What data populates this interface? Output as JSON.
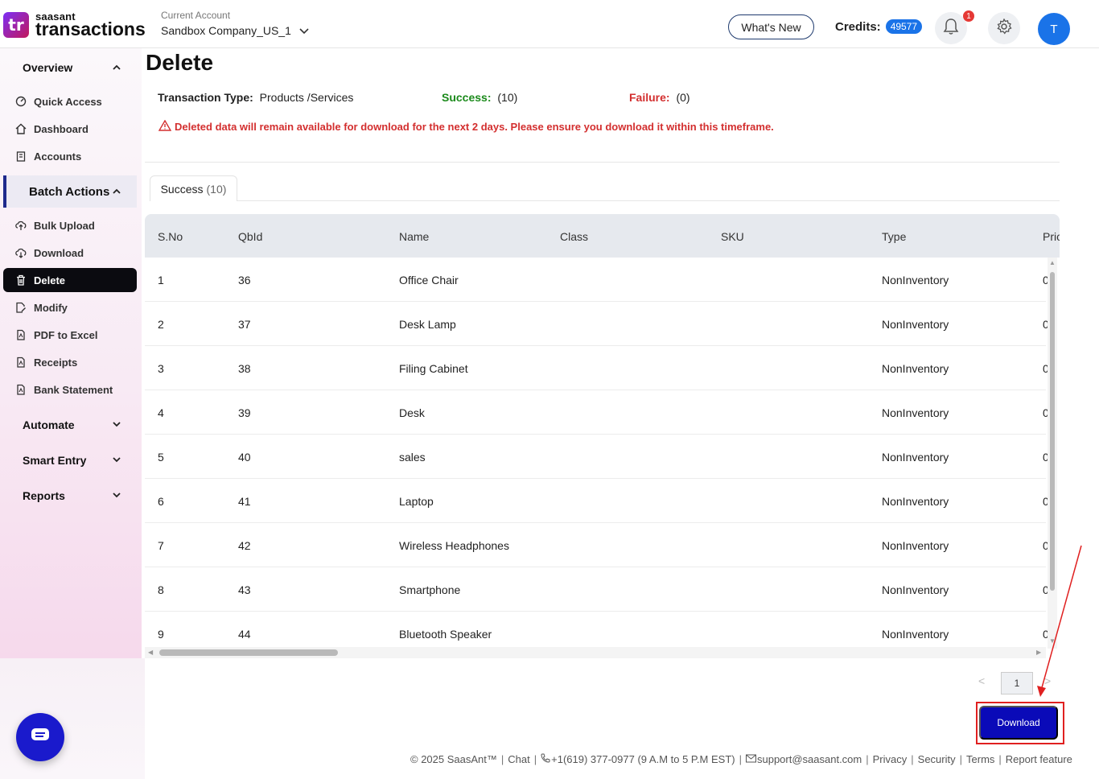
{
  "header": {
    "brand": "saasant",
    "product": "transactions",
    "logo_mark": "tr",
    "account_caption": "Current Account",
    "account_name": "Sandbox Company_US_1",
    "whats_new": "What's New",
    "credits_label": "Credits:",
    "credits_value": "49577",
    "notification_count": "1",
    "avatar_initial": "T"
  },
  "sidebar": {
    "overview": "Overview",
    "overview_items": [
      {
        "label": "Quick Access",
        "icon": "gauge-icon"
      },
      {
        "label": "Dashboard",
        "icon": "home-icon"
      },
      {
        "label": "Accounts",
        "icon": "clipboard-icon"
      }
    ],
    "batch_actions": "Batch Actions",
    "batch_items": [
      {
        "label": "Bulk Upload",
        "icon": "cloud-upload-icon"
      },
      {
        "label": "Download",
        "icon": "cloud-download-icon"
      },
      {
        "label": "Delete",
        "icon": "trash-icon"
      },
      {
        "label": "Modify",
        "icon": "edit-file-icon"
      },
      {
        "label": "PDF to Excel",
        "icon": "pdf-icon"
      },
      {
        "label": "Receipts",
        "icon": "receipt-icon"
      },
      {
        "label": "Bank Statement",
        "icon": "bank-statement-icon"
      }
    ],
    "automate": "Automate",
    "smart_entry": "Smart Entry",
    "reports": "Reports"
  },
  "main": {
    "title": "Delete",
    "transaction_type_label": "Transaction Type:",
    "transaction_type_value": "Products /Services",
    "success_label": "Success:",
    "success_value": "(10)",
    "failure_label": "Failure:",
    "failure_value": "(0)",
    "warning": "Deleted data will remain available for download for the next 2 days. Please ensure you download it within this timeframe.",
    "tab_label": "Success",
    "tab_count": "(10)"
  },
  "table": {
    "headers": [
      "S.No",
      "QbId",
      "Name",
      "Class",
      "SKU",
      "Type",
      "Pric"
    ],
    "rows": [
      [
        "1",
        "36",
        "Office Chair",
        "",
        "",
        "NonInventory",
        "0"
      ],
      [
        "2",
        "37",
        "Desk Lamp",
        "",
        "",
        "NonInventory",
        "0"
      ],
      [
        "3",
        "38",
        "Filing Cabinet",
        "",
        "",
        "NonInventory",
        "0"
      ],
      [
        "4",
        "39",
        "Desk",
        "",
        "",
        "NonInventory",
        "0"
      ],
      [
        "5",
        "40",
        "sales",
        "",
        "",
        "NonInventory",
        "0"
      ],
      [
        "6",
        "41",
        "Laptop",
        "",
        "",
        "NonInventory",
        "0"
      ],
      [
        "7",
        "42",
        "Wireless Headphones",
        "",
        "",
        "NonInventory",
        "0"
      ],
      [
        "8",
        "43",
        "Smartphone",
        "",
        "",
        "NonInventory",
        "0"
      ],
      [
        "9",
        "44",
        "Bluetooth Speaker",
        "",
        "",
        "NonInventory",
        "0"
      ]
    ]
  },
  "pagination": {
    "prev": "<",
    "page": "1",
    "next": ">"
  },
  "download_button": "Download",
  "footer": {
    "copyright": "© 2025 SaasAnt™",
    "chat": "Chat",
    "phone": "+1(619) 377-0977 (9 A.M to 5 P.M EST)",
    "email": "support@saasant.com",
    "privacy": "Privacy",
    "security": "Security",
    "terms": "Terms",
    "report": "Report feature"
  },
  "colors": {
    "accent": "#0a0ab8",
    "success": "#1b8a1b",
    "failure": "#d32f2f",
    "highlight": "#e02020"
  }
}
